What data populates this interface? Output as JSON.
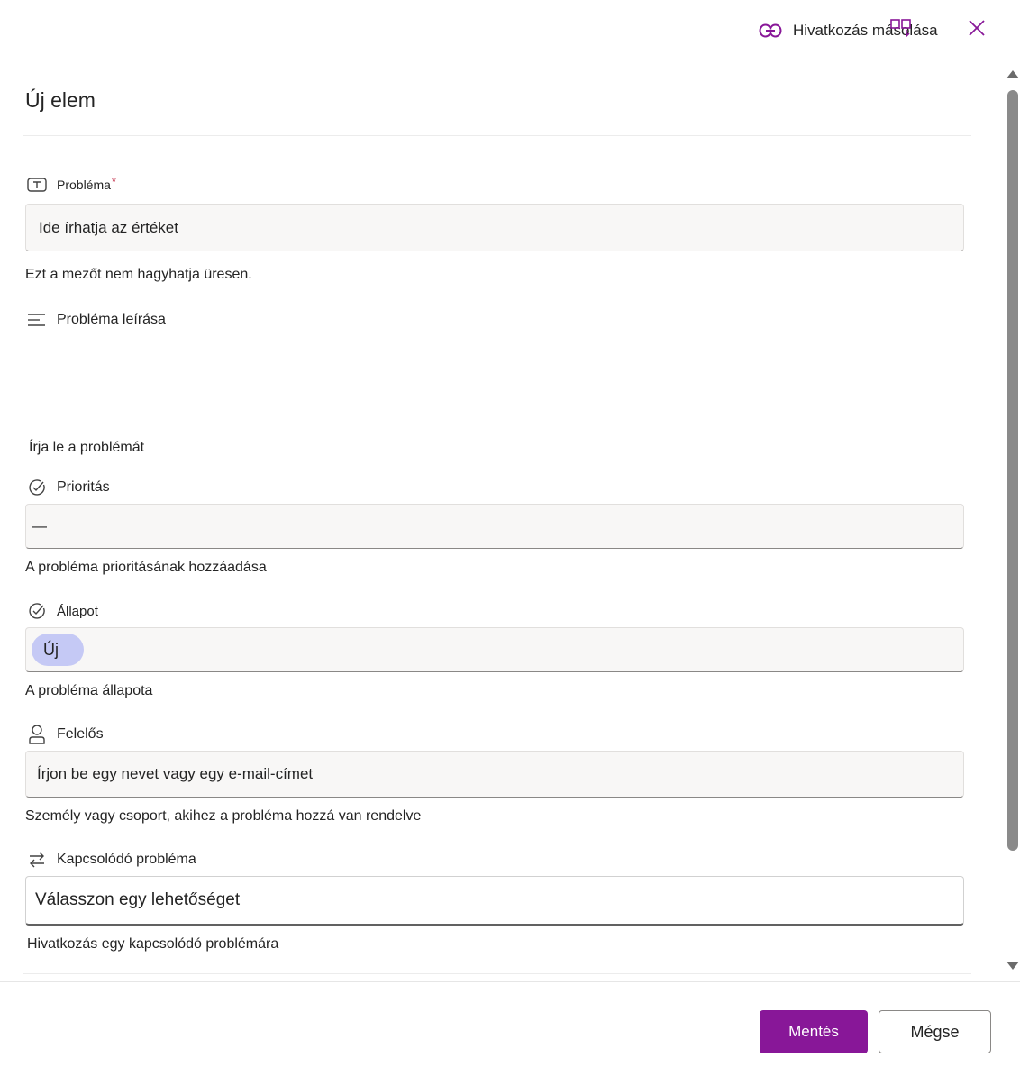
{
  "header": {
    "copy_link_label": "Hivatkozás másolása",
    "copy_link_icon": "link-icon",
    "view_icon": "split-view-icon",
    "close_icon": "close-icon"
  },
  "form": {
    "title": "Új elem",
    "fields": {
      "problem": {
        "label": "Probléma",
        "required_mark": "*",
        "icon": "text-field-icon",
        "placeholder": "Ide írhatja az értéket",
        "help": "Ezt a mezőt nem hagyhatja üresen."
      },
      "description": {
        "label": "Probléma leírása",
        "icon": "multiline-text-icon",
        "help": "Írja le a problémát"
      },
      "priority": {
        "label": "Prioritás",
        "icon": "choice-check-icon",
        "value": "—",
        "help": "A probléma prioritásának hozzáadása"
      },
      "status": {
        "label": "Állapot",
        "icon": "choice-check-icon",
        "value": "Új",
        "help": "A probléma állapota"
      },
      "assignee": {
        "label": "Felelős",
        "icon": "person-icon",
        "placeholder": "Írjon be egy nevet vagy egy e-mail-címet",
        "help": "Személy vagy csoport, akihez a probléma hozzá van rendelve"
      },
      "related": {
        "label": "Kapcsolódó probléma",
        "icon": "swap-arrows-icon",
        "placeholder": "Válasszon egy lehetőséget",
        "help": "Hivatkozás egy kapcsolódó problémára"
      }
    }
  },
  "footer": {
    "save_label": "Mentés",
    "cancel_label": "Mégse"
  },
  "colors": {
    "accent": "#881798",
    "status_pill": "#c5c9f5",
    "field_bg": "#f8f7f6"
  }
}
